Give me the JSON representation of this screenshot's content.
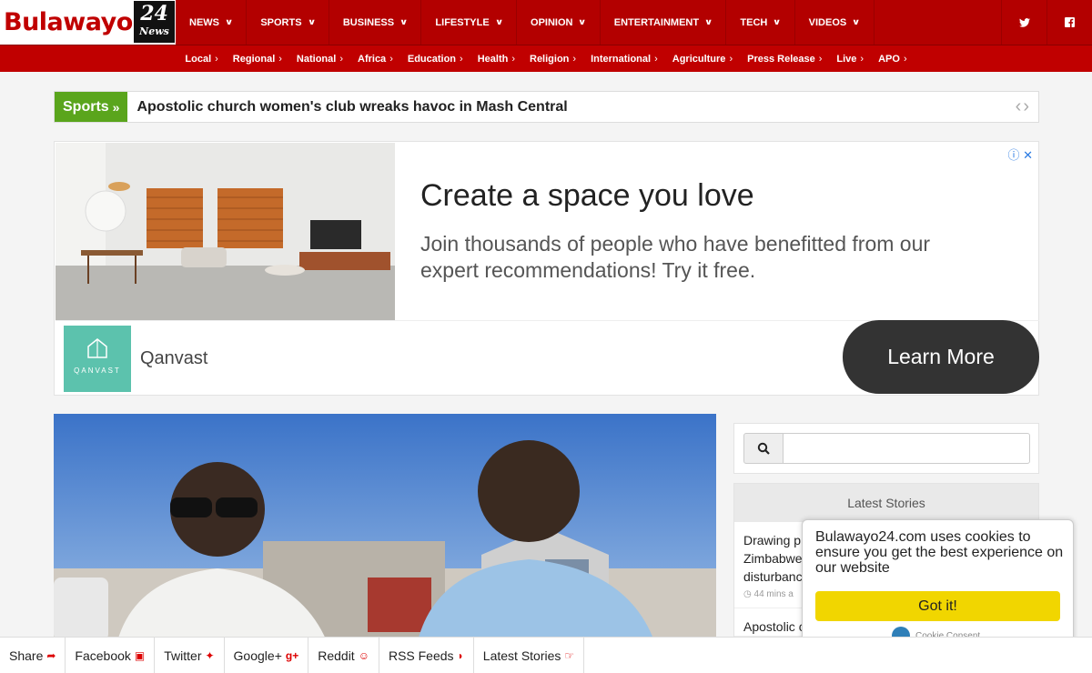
{
  "header": {
    "logo_text": "Bulawayo",
    "logo_badge_number": "24",
    "logo_badge_word": "News",
    "menu": [
      {
        "label": "NEWS"
      },
      {
        "label": "SPORTS"
      },
      {
        "label": "BUSINESS"
      },
      {
        "label": "LIFESTYLE"
      },
      {
        "label": "OPINION"
      },
      {
        "label": "ENTERTAINMENT"
      },
      {
        "label": "TECH"
      },
      {
        "label": "VIDEOS"
      }
    ],
    "social": [
      {
        "icon": "twitter-icon",
        "glyph": "t"
      },
      {
        "icon": "facebook-icon",
        "glyph": "f"
      }
    ]
  },
  "subnav": [
    {
      "label": "Local"
    },
    {
      "label": "Regional"
    },
    {
      "label": "National"
    },
    {
      "label": "Africa"
    },
    {
      "label": "Education"
    },
    {
      "label": "Health"
    },
    {
      "label": "Religion"
    },
    {
      "label": "International"
    },
    {
      "label": "Agriculture"
    },
    {
      "label": "Press Release"
    },
    {
      "label": "Live"
    },
    {
      "label": "APO"
    }
  ],
  "ticker": {
    "label": "Sports",
    "headline": "Apostolic church women's club wreaks havoc in Mash Central"
  },
  "ad": {
    "headline": "Create a space you love",
    "body": "Join thousands of people who have benefitted from our expert recommendations! Try it free.",
    "brand": "Qanvast",
    "logo_text": "QANVAST",
    "cta": "Learn More"
  },
  "sidebar": {
    "search_placeholder": "",
    "latest_title": "Latest Stories",
    "stories": [
      {
        "lines": [
          "Drawing p",
          "Zimbabwe",
          "disturbanc"
        ],
        "meta": "44 mins a"
      },
      {
        "lines": [
          "Apostolic c"
        ],
        "meta": ""
      }
    ]
  },
  "cookie": {
    "message": "Bulawayo24.com uses cookies to ensure you get the best experience on our website",
    "button": "Got it!",
    "footer": "Cookie Consent"
  },
  "sharebar": [
    {
      "label": "Share",
      "icon": "share-icon",
      "glyph": "➦"
    },
    {
      "label": "Facebook",
      "icon": "facebook-icon",
      "glyph": "f"
    },
    {
      "label": "Twitter",
      "icon": "twitter-icon",
      "glyph": "t"
    },
    {
      "label": "Google+",
      "icon": "google-plus-icon",
      "glyph": "g+"
    },
    {
      "label": "Reddit",
      "icon": "reddit-icon",
      "glyph": "☺"
    },
    {
      "label": "RSS Feeds",
      "icon": "rss-icon",
      "glyph": "◗"
    },
    {
      "label": "Latest Stories",
      "icon": "hand-pointer-icon",
      "glyph": "☞"
    }
  ],
  "colors": {
    "brand_red": "#b30000",
    "sports_green": "#5aa51c",
    "cookie_yellow": "#f1d600",
    "ad_teal": "#5cc2ad"
  }
}
